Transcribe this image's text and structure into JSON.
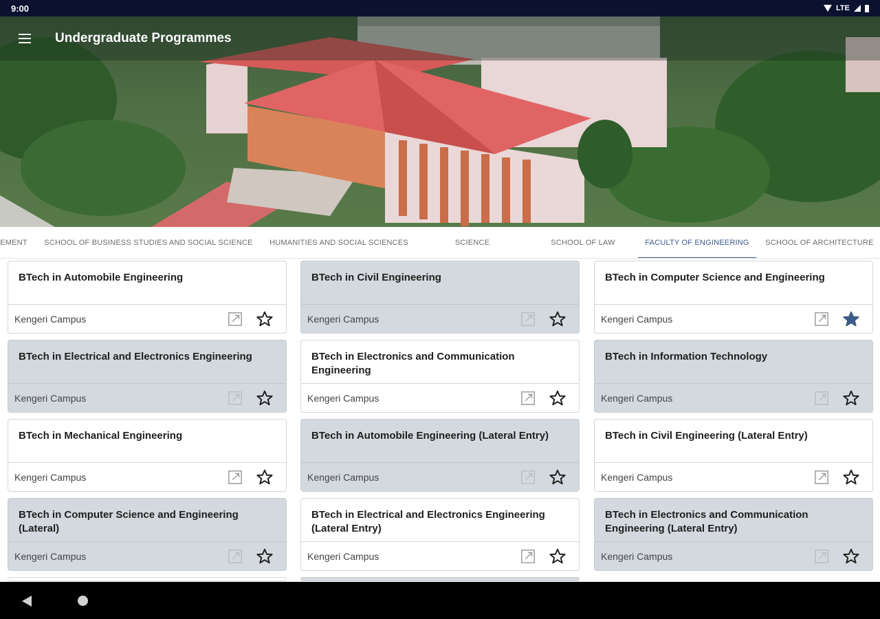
{
  "status_bar": {
    "time": "9:00",
    "network": "LTE"
  },
  "app_bar": {
    "title": "Undergraduate Programmes"
  },
  "tabs": [
    {
      "label": "EMENT",
      "active": false
    },
    {
      "label": "SCHOOL OF BUSINESS STUDIES AND SOCIAL SCIENCE",
      "active": false
    },
    {
      "label": "HUMANITIES AND SOCIAL SCIENCES",
      "active": false
    },
    {
      "label": "SCIENCE",
      "active": false
    },
    {
      "label": "SCHOOL OF LAW",
      "active": false
    },
    {
      "label": "FACULTY OF ENGINEERING",
      "active": true
    },
    {
      "label": "SCHOOL OF ARCHITECTURE",
      "active": false
    }
  ],
  "programmes": [
    {
      "title": "BTech in Automobile Engineering",
      "campus": "Kengeri Campus",
      "favorite": false
    },
    {
      "title": "BTech in Civil Engineering",
      "campus": "Kengeri Campus",
      "favorite": false
    },
    {
      "title": "BTech in Computer Science and Engineering",
      "campus": "Kengeri Campus",
      "favorite": true
    },
    {
      "title": "BTech in Electrical and Electronics Engineering",
      "campus": "Kengeri Campus",
      "favorite": false
    },
    {
      "title": "BTech in Electronics and Communication Engineering",
      "campus": "Kengeri Campus",
      "favorite": false
    },
    {
      "title": "BTech in Information Technology",
      "campus": "Kengeri Campus",
      "favorite": false
    },
    {
      "title": "BTech in Mechanical Engineering",
      "campus": "Kengeri Campus",
      "favorite": false
    },
    {
      "title": "BTech in Automobile Engineering (Lateral Entry)",
      "campus": "Kengeri Campus",
      "favorite": false
    },
    {
      "title": "BTech in Civil Engineering (Lateral Entry)",
      "campus": "Kengeri Campus",
      "favorite": false
    },
    {
      "title": "BTech in Computer Science and Engineering (Lateral)",
      "campus": "Kengeri Campus",
      "favorite": false
    },
    {
      "title": "BTech in Electrical and Electronics Engineering (Lateral Entry)",
      "campus": "Kengeri Campus",
      "favorite": false
    },
    {
      "title": "BTech in Electronics and Communication Engineering (Lateral Entry)",
      "campus": "Kengeri Campus",
      "favorite": false
    }
  ],
  "colors": {
    "accent": "#3a5a8a",
    "favorite_star": "#3a5a8a",
    "card_shaded": "#d3d9de",
    "status_bar": "#0b1230"
  },
  "icons": {
    "menu": "hamburger-menu-icon",
    "open": "open-in-new-icon",
    "star": "star-icon"
  }
}
